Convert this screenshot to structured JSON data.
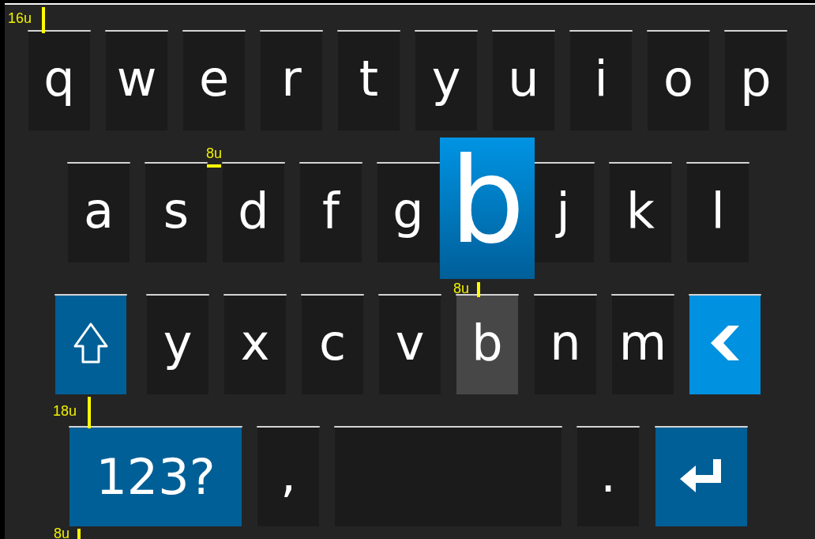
{
  "keyboard": {
    "rows": [
      {
        "keys": [
          {
            "kind": "letter",
            "label": "q",
            "pressed": false
          },
          {
            "kind": "letter",
            "label": "w",
            "pressed": false
          },
          {
            "kind": "letter",
            "label": "e",
            "pressed": false
          },
          {
            "kind": "letter",
            "label": "r",
            "pressed": false
          },
          {
            "kind": "letter",
            "label": "t",
            "pressed": false
          },
          {
            "kind": "letter",
            "label": "y",
            "pressed": false
          },
          {
            "kind": "letter",
            "label": "u",
            "pressed": false
          },
          {
            "kind": "letter",
            "label": "i",
            "pressed": false
          },
          {
            "kind": "letter",
            "label": "o",
            "pressed": false
          },
          {
            "kind": "letter",
            "label": "p",
            "pressed": false
          }
        ]
      },
      {
        "keys": [
          {
            "kind": "letter",
            "label": "a",
            "pressed": false
          },
          {
            "kind": "letter",
            "label": "s",
            "pressed": false
          },
          {
            "kind": "letter",
            "label": "d",
            "pressed": false
          },
          {
            "kind": "letter",
            "label": "f",
            "pressed": false
          },
          {
            "kind": "letter",
            "label": "g",
            "pressed": false
          },
          {
            "kind": "letter",
            "label": "j",
            "pressed": false
          },
          {
            "kind": "letter",
            "label": "k",
            "pressed": false
          },
          {
            "kind": "letter",
            "label": "l",
            "pressed": false
          }
        ]
      },
      {
        "keys": [
          {
            "kind": "shift"
          },
          {
            "kind": "letter",
            "label": "y",
            "pressed": false
          },
          {
            "kind": "letter",
            "label": "x",
            "pressed": false
          },
          {
            "kind": "letter",
            "label": "c",
            "pressed": false
          },
          {
            "kind": "letter",
            "label": "v",
            "pressed": false
          },
          {
            "kind": "letter",
            "label": "b",
            "pressed": true
          },
          {
            "kind": "letter",
            "label": "n",
            "pressed": false
          },
          {
            "kind": "letter",
            "label": "m",
            "pressed": false
          },
          {
            "kind": "backspace"
          }
        ]
      },
      {
        "keys": [
          {
            "kind": "mode",
            "label": "123?"
          },
          {
            "kind": "letter",
            "label": ",",
            "pressed": false
          },
          {
            "kind": "space"
          },
          {
            "kind": "letter",
            "label": ".",
            "pressed": false
          },
          {
            "kind": "enter"
          }
        ]
      }
    ],
    "popup": {
      "label": "b"
    }
  },
  "annotations": [
    {
      "label": "16u"
    },
    {
      "label": "8u"
    },
    {
      "label": "8u"
    },
    {
      "label": "18u"
    },
    {
      "label": "8u"
    }
  ]
}
